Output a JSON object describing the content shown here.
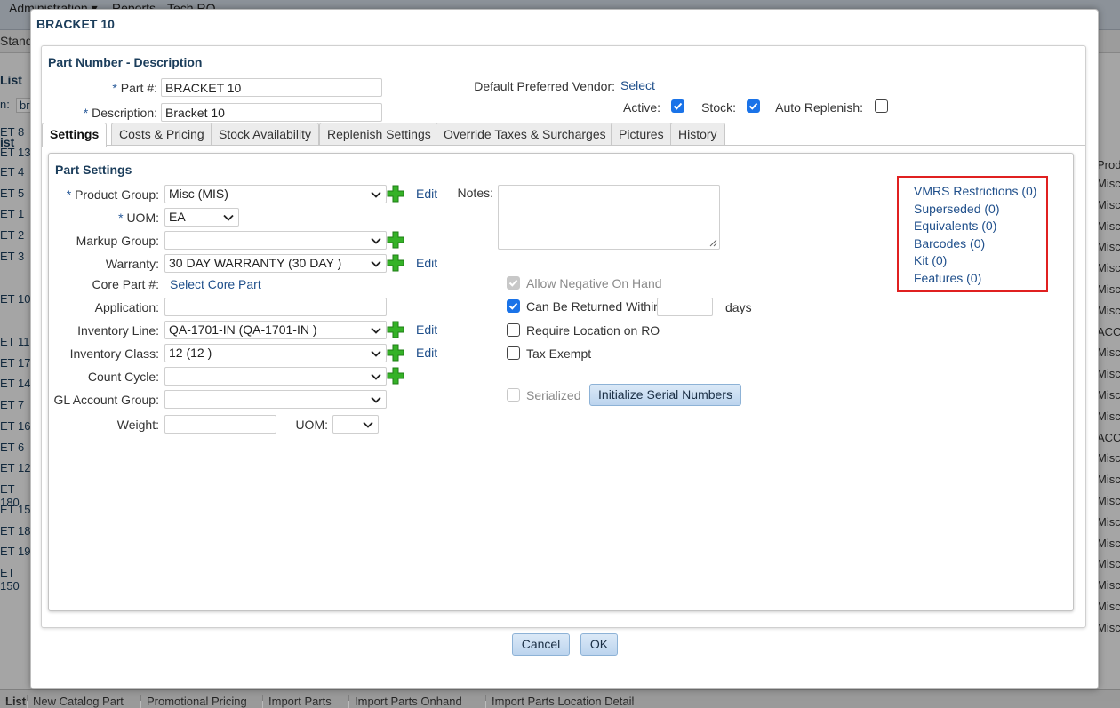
{
  "background": {
    "menu_items": [
      "Administration ▾",
      "Reports",
      "Tech RO"
    ],
    "sub_label": "Standa",
    "list_header_1": "List",
    "search_label": "n:",
    "search_value": "br",
    "list_header_2": "ist",
    "rows_left": [
      "ET 8",
      "ET 13",
      "ET 4",
      "ET 5",
      "ET 1",
      "ET 2",
      "ET 3",
      "ET 10",
      "ET 11",
      "ET 17",
      "ET 14",
      "ET 7",
      "ET 16",
      "ET 6",
      "ET 12",
      "ET 180",
      "ET 15",
      "ET 18",
      "ET 19",
      "ET 150"
    ],
    "right_header": "Prod",
    "rows_right": [
      "Misc",
      "Misc",
      "Misc",
      "Misc",
      "Misc",
      "Misc",
      "Misc",
      "ACC",
      "Misc",
      "Misc",
      "Misc",
      "Misc",
      "ACC",
      "Misc",
      "Misc",
      "Misc",
      "Misc",
      "Misc",
      "Misc",
      "Misc",
      "Misc",
      "Misc"
    ],
    "bottom_tabs": [
      "List",
      "New Catalog Part",
      "Promotional Pricing",
      "Import Parts",
      "Import Parts Onhand",
      "Import Parts Location Detail"
    ]
  },
  "dialog": {
    "title": "BRACKET 10",
    "section_title": "Part Number - Description",
    "part_no_label": "Part #:",
    "part_no_value": "BRACKET 10",
    "description_label": "Description:",
    "description_value": "Bracket 10",
    "vendor_label": "Default Preferred Vendor:",
    "vendor_link": "Select",
    "active_label": "Active:",
    "stock_label": "Stock:",
    "auto_replenish_label": "Auto Replenish:",
    "active_checked": true,
    "stock_checked": true,
    "auto_replenish_checked": false,
    "tabs": [
      "Settings",
      "Costs & Pricing",
      "Stock Availability",
      "Replenish Settings",
      "Override Taxes & Surcharges",
      "Pictures",
      "History"
    ],
    "active_tab": "Settings",
    "settings": {
      "title": "Part Settings",
      "product_group_label": "Product Group:",
      "product_group_value": "Misc (MIS)",
      "uom_label": "UOM:",
      "uom_value": "EA",
      "markup_group_label": "Markup Group:",
      "markup_group_value": "",
      "warranty_label": "Warranty:",
      "warranty_value": "30 DAY WARRANTY (30 DAY )",
      "core_part_label": "Core Part #:",
      "core_part_link": "Select Core Part",
      "application_label": "Application:",
      "application_value": "",
      "inventory_line_label": "Inventory Line:",
      "inventory_line_value": "QA-1701-IN (QA-1701-IN )",
      "inventory_class_label": "Inventory Class:",
      "inventory_class_value": "12 (12 )",
      "count_cycle_label": "Count Cycle:",
      "count_cycle_value": "",
      "gl_account_label": "GL Account Group:",
      "gl_account_value": "",
      "weight_label": "Weight:",
      "weight_value": "",
      "weight_uom_label": "UOM:",
      "weight_uom_value": "",
      "edit_link": "Edit",
      "notes_label": "Notes:",
      "notes_value": "",
      "allow_negative_label": "Allow Negative On Hand",
      "can_be_returned_label": "Can Be Returned Within",
      "days_value": "",
      "days_label": "days",
      "require_location_label": "Require Location on RO",
      "tax_exempt_label": "Tax Exempt",
      "serialized_label": "Serialized",
      "init_serial_button": "Initialize Serial Numbers",
      "allow_negative_checked": true,
      "can_be_returned_checked": true,
      "require_location_checked": false,
      "tax_exempt_checked": false,
      "serialized_checked": false,
      "side_links": [
        "VMRS Restrictions (0)",
        "Superseded (0)",
        "Equivalents (0)",
        "Barcodes (0)",
        "Kit (0)",
        "Features (0)"
      ]
    },
    "cancel_button": "Cancel",
    "ok_button": "OK"
  },
  "colors": {
    "link": "#1f4f8b",
    "title": "#1b3d5b",
    "checkbox_on": "#1a73e8",
    "plus_green": "#2fae1f",
    "highlight_red": "#e02020"
  }
}
